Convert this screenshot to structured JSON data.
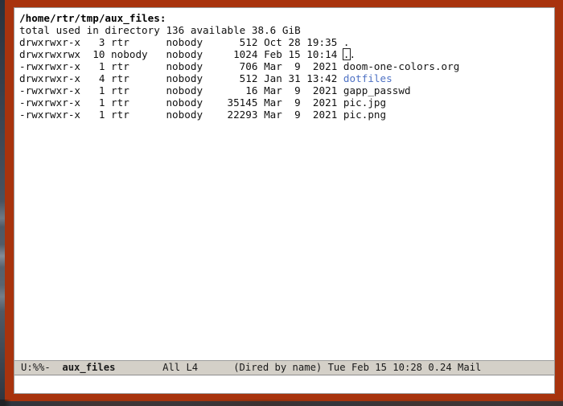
{
  "window": {
    "border_color": "#a8330d",
    "background": "#ffffff",
    "desktop_color": "#3c4450"
  },
  "buffer": {
    "directory_header": "/home/rtr/tmp/aux_files:",
    "summary_line": "total used in directory 136 available 38.6 GiB",
    "columns": [
      "permissions",
      "links",
      "owner",
      "group",
      "size",
      "month",
      "day",
      "time",
      "name"
    ],
    "entries": [
      {
        "permissions": "drwxrwxr-x",
        "links": "3",
        "owner": "rtr",
        "group": "nobody",
        "size": "512",
        "month": "Oct",
        "day": "28",
        "time": "19:35",
        "name": ".",
        "is_directory": true,
        "has_cursor": false,
        "prefix": "",
        "cursor_char": "",
        "suffix": "."
      },
      {
        "permissions": "drwxrwxrwx",
        "links": "10",
        "owner": "nobody",
        "group": "nobody",
        "size": "1024",
        "month": "Feb",
        "day": "15",
        "time": "10:14",
        "name": "..",
        "is_directory": true,
        "has_cursor": true,
        "prefix": "",
        "cursor_char": ".",
        "suffix": "."
      },
      {
        "permissions": "-rwxrwxr-x",
        "links": "1",
        "owner": "rtr",
        "group": "nobody",
        "size": "706",
        "month": "Mar",
        "day": "9",
        "time": "2021",
        "name": "doom-one-colors.org",
        "is_directory": false,
        "has_cursor": false,
        "prefix": "",
        "cursor_char": "",
        "suffix": "doom-one-colors.org"
      },
      {
        "permissions": "drwxrwxr-x",
        "links": "4",
        "owner": "rtr",
        "group": "nobody",
        "size": "512",
        "month": "Jan",
        "day": "31",
        "time": "13:42",
        "name": "dotfiles",
        "is_directory": true,
        "has_cursor": false,
        "prefix": "",
        "cursor_char": "",
        "suffix": "dotfiles"
      },
      {
        "permissions": "-rwxrwxr-x",
        "links": "1",
        "owner": "rtr",
        "group": "nobody",
        "size": "16",
        "month": "Mar",
        "day": "9",
        "time": "2021",
        "name": "gapp_passwd",
        "is_directory": false,
        "has_cursor": false,
        "prefix": "",
        "cursor_char": "",
        "suffix": "gapp_passwd"
      },
      {
        "permissions": "-rwxrwxr-x",
        "links": "1",
        "owner": "rtr",
        "group": "nobody",
        "size": "35145",
        "month": "Mar",
        "day": "9",
        "time": "2021",
        "name": "pic.jpg",
        "is_directory": false,
        "has_cursor": false,
        "prefix": "",
        "cursor_char": "",
        "suffix": "pic.jpg"
      },
      {
        "permissions": "-rwxrwxr-x",
        "links": "1",
        "owner": "rtr",
        "group": "nobody",
        "size": "22293",
        "month": "Mar",
        "day": "9",
        "time": "2021",
        "name": "pic.png",
        "is_directory": false,
        "has_cursor": false,
        "prefix": "",
        "cursor_char": "",
        "suffix": "pic.png"
      }
    ],
    "rendered_rows": [
      "drwxrwxr-x   3 rtr      nobody      512 Oct 28 19:35 ",
      "drwxrwxrwx  10 nobody   nobody     1024 Feb 15 10:14 ",
      "-rwxrwxr-x   1 rtr      nobody      706 Mar  9  2021 ",
      "drwxrwxr-x   4 rtr      nobody      512 Jan 31 13:42 ",
      "-rwxrwxr-x   1 rtr      nobody       16 Mar  9  2021 ",
      "-rwxrwxr-x   1 rtr      nobody    35145 Mar  9  2021 ",
      "-rwxrwxr-x   1 rtr      nobody    22293 Mar  9  2021 "
    ],
    "dir_color": "#4f72c4",
    "text_color": "#141414"
  },
  "mode_line": {
    "full_text": "U:%%-  aux_files      All L4     (Dired by name) Tue Feb 15 10:28 0.24 Mail",
    "modified_indicator": "U:%%-",
    "gap1": "  ",
    "buffer_name": "aux_files",
    "gap2": "        ",
    "position": "All L4",
    "gap3": "      ",
    "major_mode": "(Dired by name)",
    "gap4": " ",
    "clock": "Tue Feb 15 10:28",
    "gap5": " ",
    "load_average": "0.24",
    "gap6": " ",
    "mail_indicator": "Mail",
    "background": "#d4d0c8"
  },
  "minibuffer": {
    "content": ""
  }
}
